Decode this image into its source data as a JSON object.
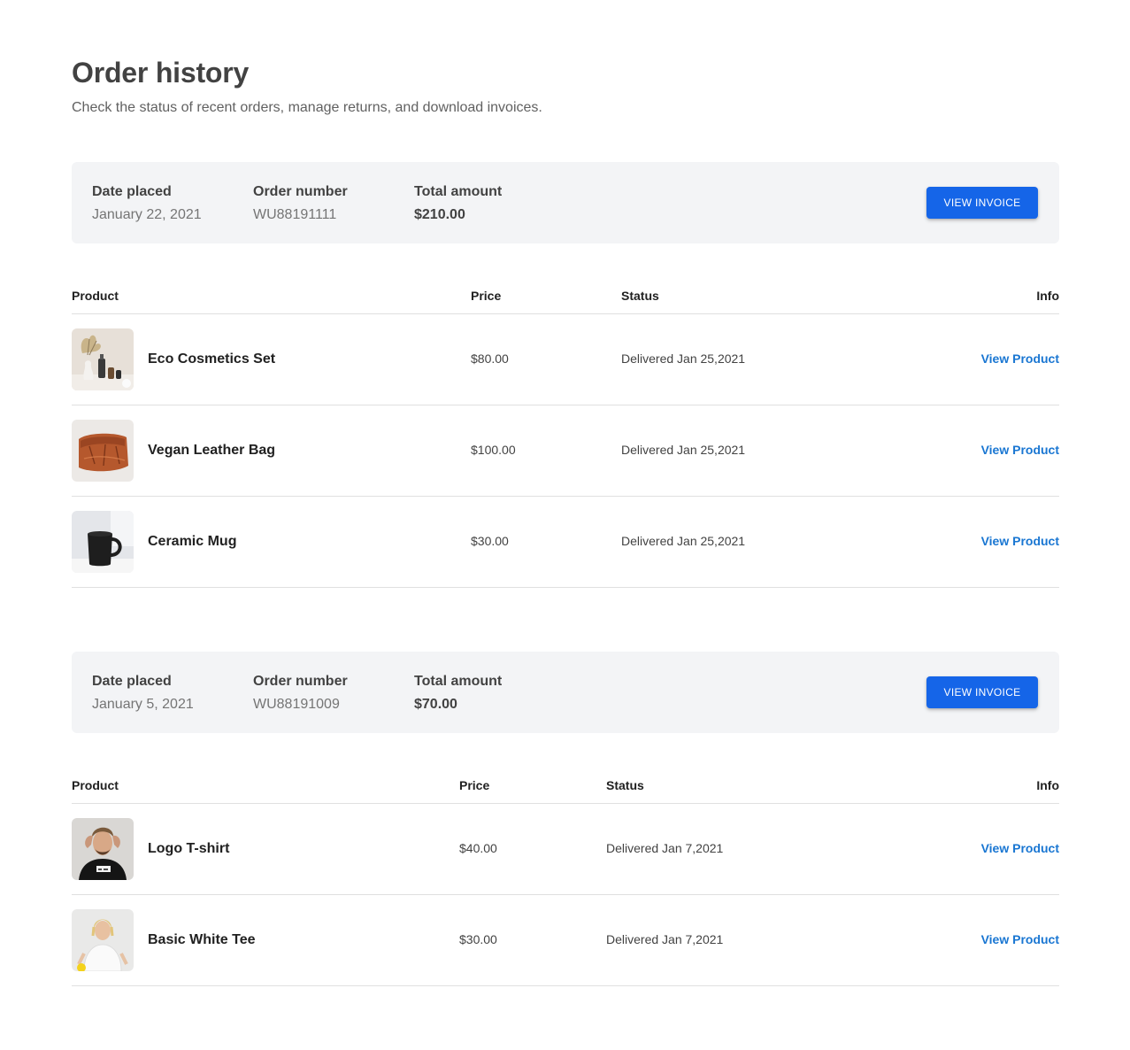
{
  "page": {
    "title": "Order history",
    "subtitle": "Check the status of recent orders, manage returns, and download invoices."
  },
  "labels": {
    "date_placed": "Date placed",
    "order_number": "Order number",
    "total_amount": "Total amount",
    "view_invoice": "VIEW INVOICE",
    "col_product": "Product",
    "col_price": "Price",
    "col_status": "Status",
    "col_info": "Info",
    "view_product": "View Product"
  },
  "orders": [
    {
      "date_placed": "January 22, 2021",
      "order_number": "WU88191111",
      "total_amount": "$210.00",
      "items": [
        {
          "name": "Eco Cosmetics Set",
          "price": "$80.00",
          "status": "Delivered Jan 25,2021",
          "image_icon": "cosmetics-image"
        },
        {
          "name": "Vegan Leather Bag",
          "price": "$100.00",
          "status": "Delivered Jan 25,2021",
          "image_icon": "leather-bag-image"
        },
        {
          "name": "Ceramic Mug",
          "price": "$30.00",
          "status": "Delivered Jan 25,2021",
          "image_icon": "mug-image"
        }
      ]
    },
    {
      "date_placed": "January 5, 2021",
      "order_number": "WU88191009",
      "total_amount": "$70.00",
      "items": [
        {
          "name": "Logo T-shirt",
          "price": "$40.00",
          "status": "Delivered Jan 7,2021",
          "image_icon": "tshirt-model-image"
        },
        {
          "name": "Basic White Tee",
          "price": "$30.00",
          "status": "Delivered Jan 7,2021",
          "image_icon": "white-tee-model-image"
        }
      ]
    }
  ],
  "colors": {
    "accent": "#1565e8",
    "link": "#1976d2",
    "summary_bg": "#f3f4f6",
    "divider": "#e0e0e0"
  }
}
